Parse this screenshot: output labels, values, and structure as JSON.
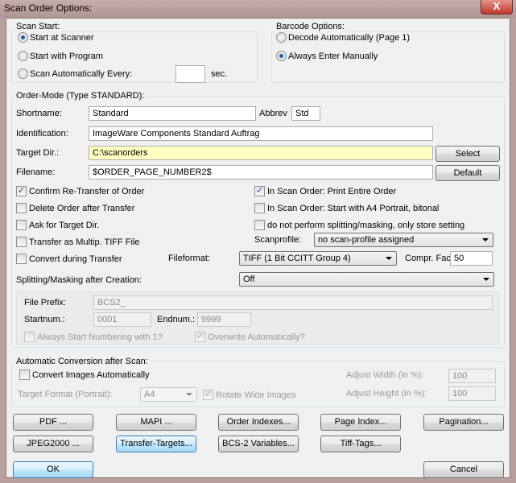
{
  "window": {
    "title": "Scan Order Options:",
    "close": "X"
  },
  "scan_start": {
    "label": "Scan Start:",
    "options": [
      {
        "label": "Start at Scanner",
        "selected": true
      },
      {
        "label": "Start with Program",
        "selected": false
      },
      {
        "label": "Scan Automatically Every:",
        "selected": false
      }
    ],
    "interval_value": "",
    "interval_unit": "sec."
  },
  "barcode": {
    "label": "Barcode Options:",
    "options": [
      {
        "label": "Decode Automatically (Page 1)",
        "selected": false
      },
      {
        "label": "Always Enter Manually",
        "selected": true
      }
    ]
  },
  "order_mode": {
    "label": "Order-Mode (Type STANDARD):",
    "shortname_label": "Shortname:",
    "shortname": "Standard",
    "abbrev_label": "Abbrev",
    "abbrev": "Std",
    "identification_label": "Identification:",
    "identification": "ImageWare Components Standard Auftrag",
    "target_dir_label": "Target Dir.:",
    "target_dir": "C:\\scanorders",
    "select_button": "Select",
    "filename_label": "Filename:",
    "filename": "$ORDER_PAGE_NUMBER2$",
    "default_button": "Default",
    "left_checks": [
      {
        "label": "Confirm Re-Transfer of Order",
        "checked": true
      },
      {
        "label": "Delete Order after Transfer",
        "checked": false
      },
      {
        "label": "Ask for Target Dir.",
        "checked": false
      },
      {
        "label": "Transfer as Multip. TIFF File",
        "checked": false
      },
      {
        "label": "Convert during Transfer",
        "checked": false
      }
    ],
    "right_checks": [
      {
        "label": "In Scan Order: Print Entire Order",
        "checked": true
      },
      {
        "label": "In Scan Order: Start with A4 Portrait, bitonal",
        "checked": false
      },
      {
        "label": "do not perform splitting/masking, only store setting",
        "checked": false
      }
    ],
    "scanprofile_label": "Scanprofile:",
    "scanprofile": "no scan-profile assigned",
    "fileformat_label": "Fileformat:",
    "fileformat": "TIFF (1 Bit CCITT Group 4)",
    "compr_label": "Compr. Factor:",
    "compr": "50",
    "splitting_label": "Splitting/Masking after Creation:",
    "splitting": "Off",
    "file_prefix_label": "File Prefix:",
    "file_prefix": "BCS2_",
    "startnum_label": "Startnum.:",
    "startnum": "0001",
    "endnum_label": "Endnum.:",
    "endnum": "9999",
    "always_start_label": "Always Start Numbering with 1?",
    "always_start_checked": false,
    "overwrite_label": "Overwrite Automatically?",
    "overwrite_checked": true
  },
  "auto_conv": {
    "label": "Automatic Conversion after Scan:",
    "convert_label": "Convert Images Automatically",
    "convert_checked": false,
    "target_format_label": "Target Format (Portrait):",
    "target_format": "A4",
    "rotate_label": "Rotate Wide Images",
    "rotate_checked": true,
    "adjust_width_label": "Adjust Width (in %):",
    "adjust_width": "100",
    "adjust_height_label": "Adjust Height (in %):",
    "adjust_height": "100"
  },
  "buttons": {
    "row1": [
      "PDF ...",
      "MAPI ...",
      "Order Indexes...",
      "Page Index...",
      "Pagination..."
    ],
    "row2": [
      "JPEG2000 ...",
      "Transfer-Targets...",
      "BCS-2 Variables...",
      "Tiff-Tags..."
    ],
    "ok": "OK",
    "cancel": "Cancel"
  }
}
